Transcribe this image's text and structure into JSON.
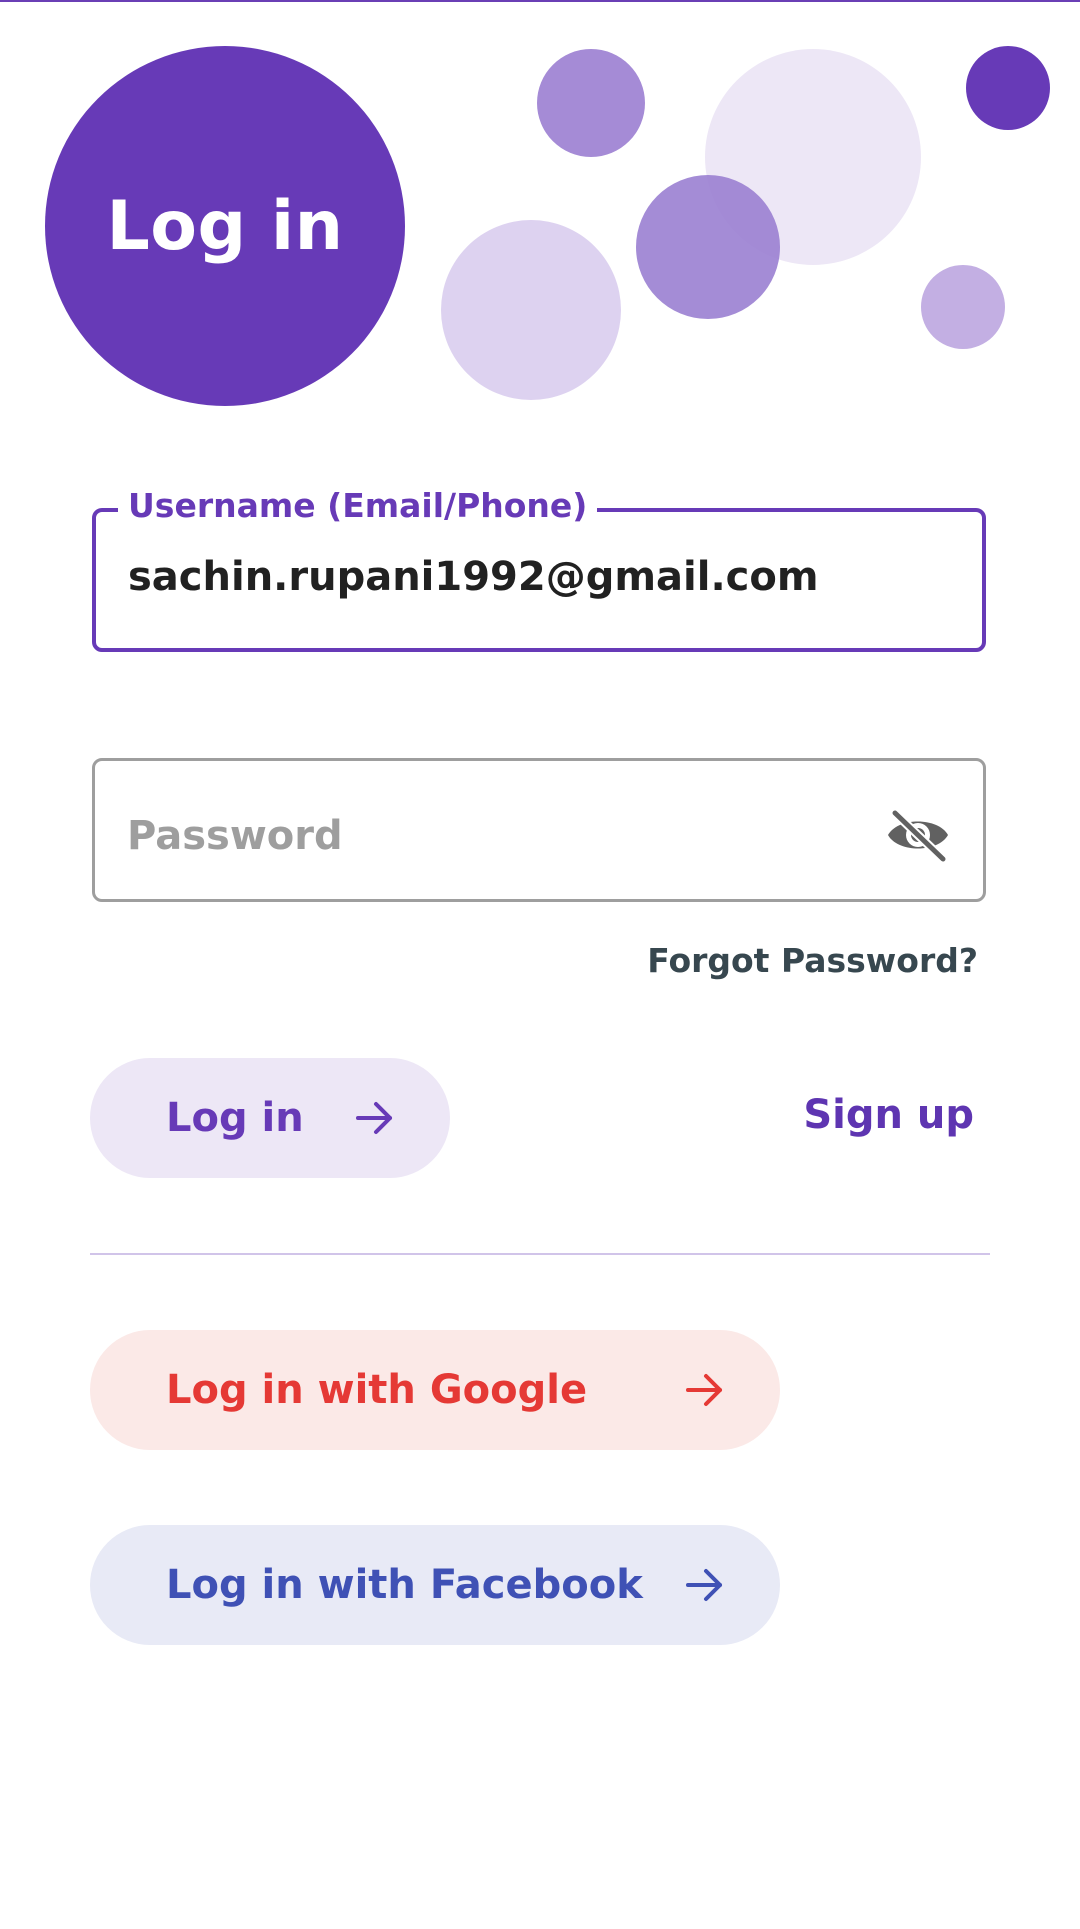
{
  "header": {
    "title": "Log in"
  },
  "form": {
    "username": {
      "label": "Username (Email/Phone)",
      "value": "sachin.rupani1992@gmail.com"
    },
    "password": {
      "placeholder": "Password",
      "toggle_icon": "visibility-off-icon"
    },
    "forgot_label": "Forgot Password?"
  },
  "actions": {
    "login_label": "Log in",
    "signup_label": "Sign up",
    "google_label": "Log in with Google",
    "facebook_label": "Log in with Facebook"
  },
  "colors": {
    "primary": "#673ab7",
    "google": "#e53935",
    "facebook": "#3f51b5"
  }
}
